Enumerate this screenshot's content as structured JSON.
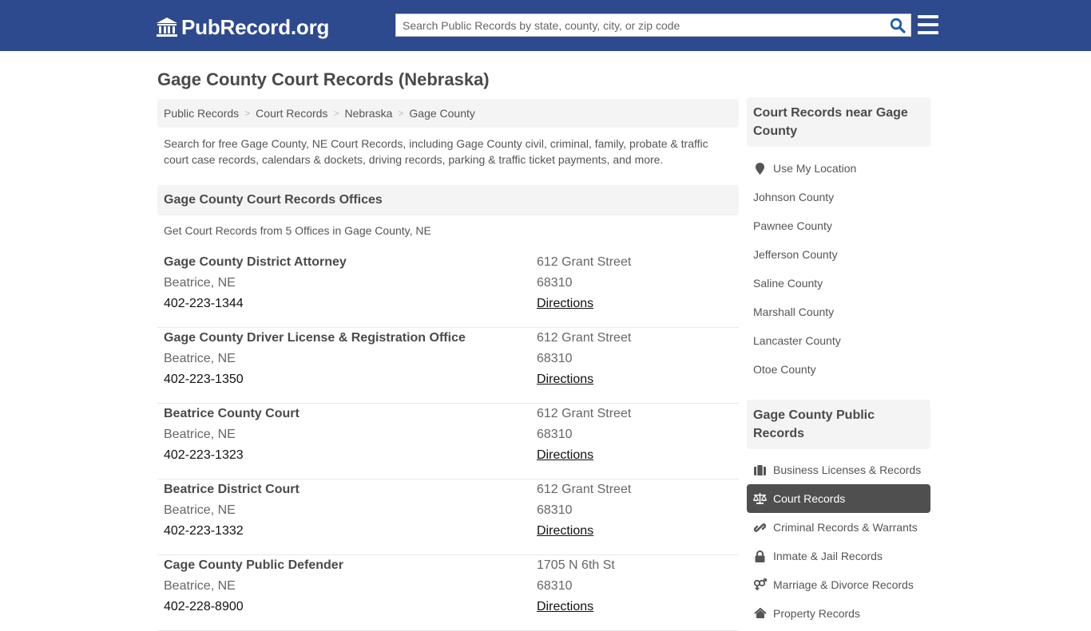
{
  "header": {
    "logo_text": "PubRecord.org",
    "search_placeholder": "Search Public Records by state, county, city, or zip code",
    "search_value": "",
    "colors": {
      "navbar": "#2e4a8e",
      "search_icon": "#1f5fa8"
    }
  },
  "page": {
    "title": "Gage County Court Records (Nebraska)",
    "breadcrumb": [
      "Public Records",
      "Court Records",
      "Nebraska",
      "Gage County"
    ],
    "breadcrumb_separator": ">",
    "intro": "Search for free Gage County, NE Court Records, including Gage County civil, criminal, family, probate & traffic court case records, calendars & dockets, driving records, parking & traffic ticket payments, and more."
  },
  "offices_section": {
    "title": "Gage County Court Records Offices",
    "subtitle": "Get Court Records from 5 Offices in Gage County, NE",
    "offices": [
      {
        "name": "Gage County District Attorney",
        "city": "Beatrice, NE",
        "phone": "402-223-1344",
        "address": "612 Grant Street",
        "zip": "68310",
        "directions": "Directions"
      },
      {
        "name": "Gage County Driver License & Registration Office",
        "city": "Beatrice, NE",
        "phone": "402-223-1350",
        "address": "612 Grant Street",
        "zip": "68310",
        "directions": "Directions"
      },
      {
        "name": "Beatrice County Court",
        "city": "Beatrice, NE",
        "phone": "402-223-1323",
        "address": "612 Grant Street",
        "zip": "68310",
        "directions": "Directions"
      },
      {
        "name": "Beatrice District Court",
        "city": "Beatrice, NE",
        "phone": "402-223-1332",
        "address": "612 Grant Street",
        "zip": "68310",
        "directions": "Directions"
      },
      {
        "name": "Cage County Public Defender",
        "city": "Beatrice, NE",
        "phone": "402-228-8900",
        "address": "1705 N 6th St",
        "zip": "68310",
        "directions": "Directions"
      }
    ]
  },
  "sidebar": {
    "nearby": {
      "title": "Court Records near Gage County",
      "use_location": {
        "label": "Use My Location",
        "icon": "map-marker-icon"
      },
      "counties": [
        "Johnson County",
        "Pawnee County",
        "Jefferson County",
        "Saline County",
        "Marshall County",
        "Lancaster County",
        "Otoe County"
      ]
    },
    "public_records": {
      "title": "Gage County Public Records",
      "items": [
        {
          "label": "Business Licenses & Records",
          "icon": "briefcase-icon",
          "active": false
        },
        {
          "label": "Court Records",
          "icon": "scales-icon",
          "active": true
        },
        {
          "label": "Criminal Records & Warrants",
          "icon": "link-icon",
          "active": false
        },
        {
          "label": "Inmate & Jail Records",
          "icon": "lock-icon",
          "active": false
        },
        {
          "label": "Marriage & Divorce Records",
          "icon": "gender-icon",
          "active": false
        },
        {
          "label": "Property Records",
          "icon": "home-icon",
          "active": false
        }
      ]
    }
  }
}
